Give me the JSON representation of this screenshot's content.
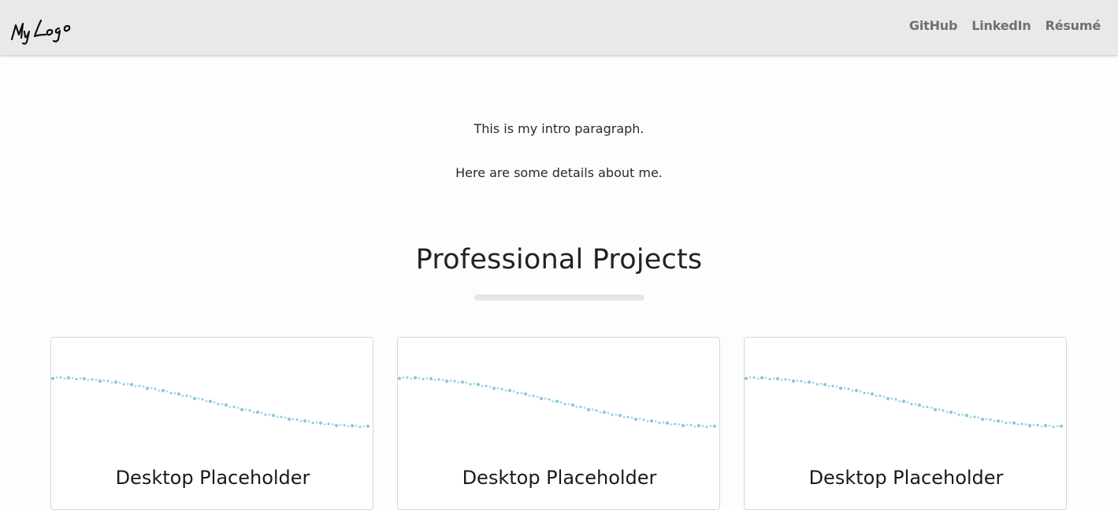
{
  "header": {
    "logo_text": "My Logo",
    "nav": [
      {
        "label": "GitHub"
      },
      {
        "label": "LinkedIn"
      },
      {
        "label": "Résumé"
      }
    ]
  },
  "intro": {
    "paragraph1": "This is my intro paragraph.",
    "paragraph2": "Here are some details about me."
  },
  "projects": {
    "title": "Professional Projects",
    "cards": [
      {
        "title": "Desktop Placeholder"
      },
      {
        "title": "Desktop Placeholder"
      },
      {
        "title": "Desktop Placeholder"
      }
    ]
  },
  "colors": {
    "navbar_bg": "#e9e9e9",
    "nav_link": "#707070",
    "wave_dots": "#7cc6d8"
  }
}
